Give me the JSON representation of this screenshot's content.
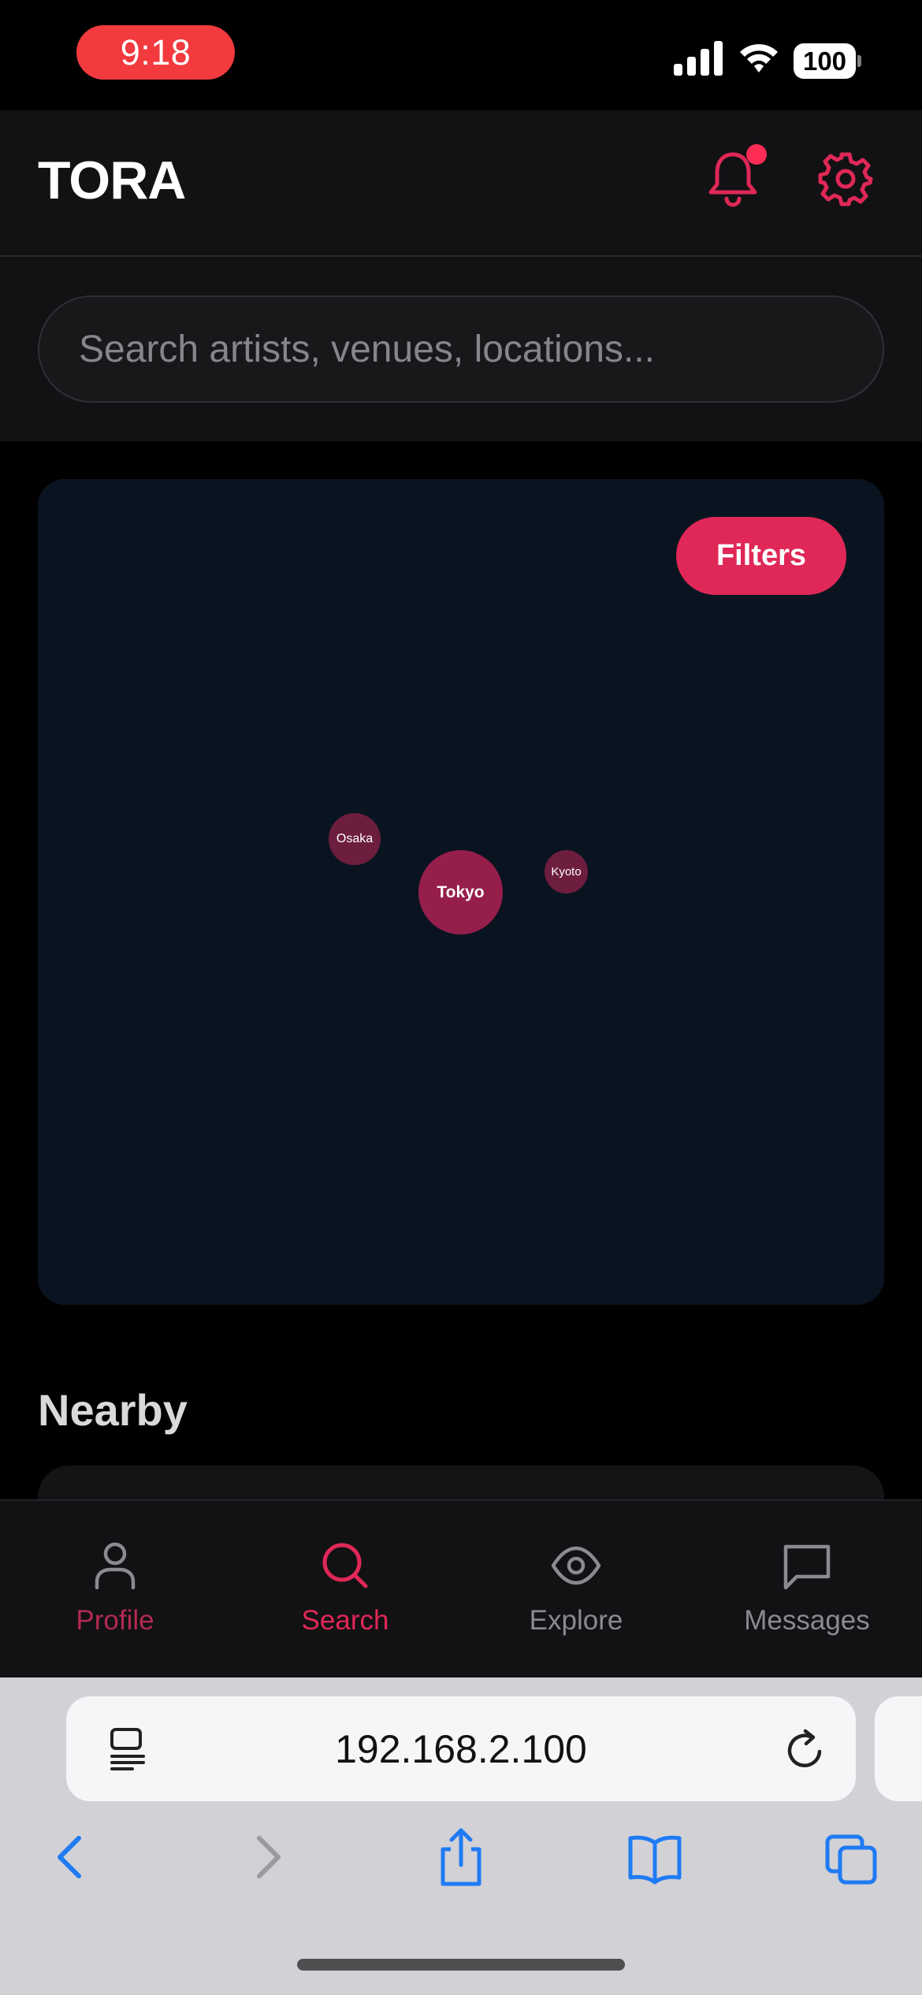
{
  "status_bar": {
    "time": "9:18",
    "battery": "100"
  },
  "header": {
    "brand": "TORA",
    "icons": [
      "bell-icon",
      "gear-icon"
    ],
    "has_notification": true
  },
  "search": {
    "placeholder": "Search artists, venues, locations..."
  },
  "map": {
    "filters_label": "Filters",
    "cities": [
      {
        "name": "Tokyo"
      },
      {
        "name": "Osaka"
      },
      {
        "name": "Kyoto"
      }
    ]
  },
  "nearby": {
    "heading": "Nearby"
  },
  "tabs": [
    {
      "label": "Profile",
      "icon": "person-icon",
      "active": false
    },
    {
      "label": "Search",
      "icon": "search-icon",
      "active": true
    },
    {
      "label": "Explore",
      "icon": "eye-icon",
      "active": false
    },
    {
      "label": "Messages",
      "icon": "chat-icon",
      "active": false
    }
  ],
  "browser": {
    "url": "192.168.2.100"
  },
  "colors": {
    "accent": "#df2857",
    "tab_inactive": "#8a8a8f",
    "map_bg": "#0a1420",
    "browser_blue": "#1f7bf4"
  }
}
